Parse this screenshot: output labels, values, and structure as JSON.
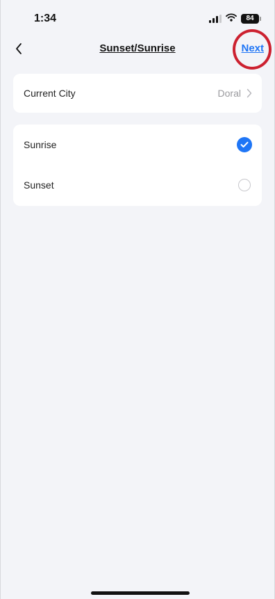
{
  "status_bar": {
    "time": "1:34",
    "battery": "84",
    "icons": [
      "signal-icon",
      "wifi-icon",
      "battery-icon"
    ]
  },
  "nav": {
    "back_icon": "chevron-left-icon",
    "title": "Sunset/Sunrise",
    "next_label": "Next"
  },
  "city": {
    "label": "Current City",
    "value": "Doral",
    "icon": "chevron-right-icon"
  },
  "options": [
    {
      "label": "Sunrise",
      "selected": true
    },
    {
      "label": "Sunset",
      "selected": false
    }
  ],
  "colors": {
    "accent": "#1f76f6",
    "background": "#f3f4f8",
    "highlight": "#cc2130"
  }
}
